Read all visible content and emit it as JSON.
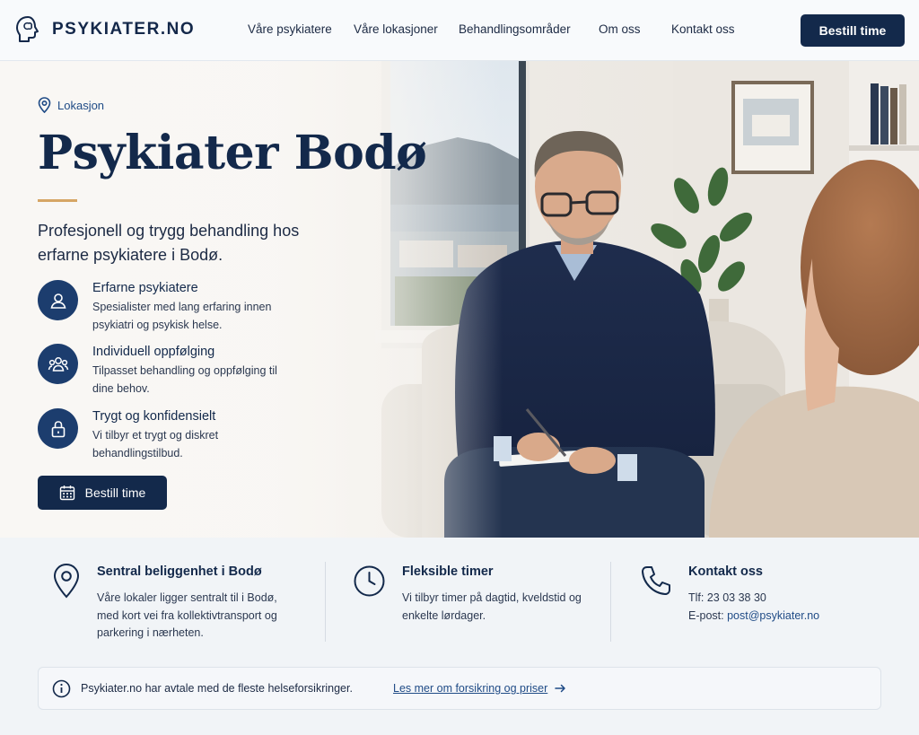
{
  "brand": {
    "name": "PSYKIATER.NO"
  },
  "nav": {
    "items": [
      {
        "label": "Våre psykiatere"
      },
      {
        "label": "Våre lokasjoner"
      },
      {
        "label": "Behandlingsområder"
      },
      {
        "label": "Om oss"
      },
      {
        "label": "Kontakt oss"
      }
    ],
    "cta_label": "Bestill time"
  },
  "hero": {
    "eyebrow": "Lokasjon",
    "title": "Psykiater Bodø",
    "subtitle": "Profesjonell og trygg behandling hos erfarne psykiatere i Bodø.",
    "features": [
      {
        "title": "Erfarne psykiatere",
        "text": "Spesialister med lang erfaring innen psykiatri og psykisk helse.",
        "icon": "user-icon"
      },
      {
        "title": "Individuell oppfølging",
        "text": "Tilpasset behandling og oppfølging til dine behov.",
        "icon": "group-icon"
      },
      {
        "title": "Trygt og konfidensielt",
        "text": "Vi tilbyr et trygt og diskret behandlingstilbud.",
        "icon": "lock-icon"
      }
    ],
    "cta_label": "Bestill time"
  },
  "info": {
    "columns": [
      {
        "title": "Sentral beliggenhet i Bodø",
        "text": "Våre lokaler ligger sentralt til i Bodø, med kort vei fra kollektivtransport og parkering i nærheten.",
        "icon": "map-pin-icon"
      },
      {
        "title": "Fleksible timer",
        "text": "Vi tilbyr timer på dagtid, kveldstid og enkelte lørdager.",
        "icon": "clock-icon"
      },
      {
        "title": "Kontakt oss",
        "phone_label": "Tlf:",
        "phone": "23 03 38 30",
        "email_label": "E-post:",
        "email": "post@psykiater.no",
        "icon": "phone-icon"
      }
    ]
  },
  "notice": {
    "text": "Psykiater.no har avtale med de fleste helseforsikringer.",
    "link_label": "Les mer om forsikring og priser"
  },
  "colors": {
    "navy": "#13294b",
    "accent": "#d6a665",
    "link": "#1f4b86"
  }
}
